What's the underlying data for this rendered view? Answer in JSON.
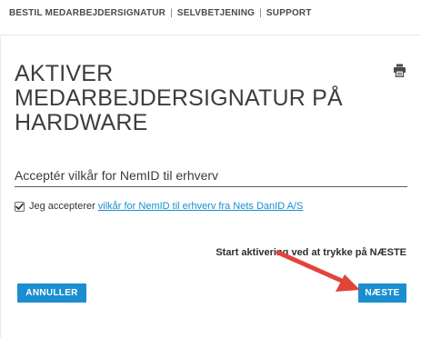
{
  "topnav": {
    "items": [
      "BESTIL MEDARBEJDERSIGNATUR",
      "SELVBETJENING",
      "SUPPORT"
    ],
    "separator": "|"
  },
  "page": {
    "title_lines": [
      "AKTIVER",
      "MEDARBEJDERSIGNATUR PÅ",
      "HARDWARE"
    ]
  },
  "section": {
    "heading": "Acceptér vilkår for NemID til erhverv"
  },
  "terms": {
    "checked": true,
    "text": "Jeg accepterer",
    "link_text": "vilkår for NemID til erhverv fra Nets DanID A/S"
  },
  "instruction": "Start aktivering ved at trykke på NÆSTE",
  "buttons": {
    "cancel": "ANNULLER",
    "next": "NÆSTE"
  },
  "icons": {
    "print": "print-icon",
    "check": "checkmark-icon",
    "annotation": "red-arrow-icon"
  },
  "colors": {
    "primary": "#1a8ed0",
    "link": "#1a8ed0",
    "annotation_arrow": "#e0443a",
    "text": "#333333"
  }
}
